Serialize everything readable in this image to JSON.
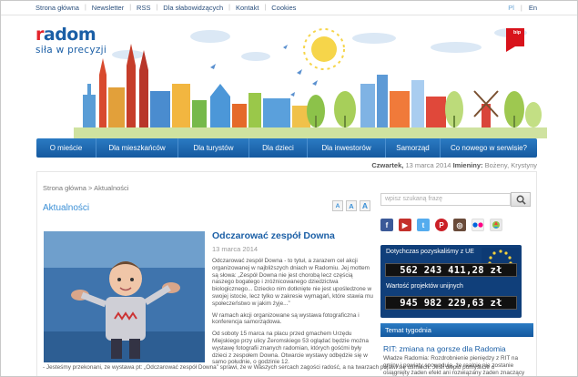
{
  "topnav": {
    "items": [
      "Strona główna",
      "Newsletter",
      "RSS",
      "Dla słabowidzących",
      "Kontakt",
      "Cookies"
    ],
    "lang": {
      "pl": "Pl",
      "en": "En"
    }
  },
  "logo": {
    "mark_r": "r",
    "mark_rest": "adom",
    "tagline": "siła w precyzji"
  },
  "bip": {
    "label": "bip"
  },
  "mainnav": {
    "items": [
      "O mieście",
      "Dla mieszkańców",
      "Dla turystów",
      "Dla dzieci",
      "Dla inwestorów",
      "Samorząd",
      "Co nowego w serwisie?"
    ]
  },
  "datebar": {
    "day": "Czwartek,",
    "date": "13 marca 2014",
    "names_label": "Imieniny:",
    "names": "Bożeny, Krystyny"
  },
  "breadcrumb": {
    "home": "Strona główna",
    "sep": ">",
    "current": "Aktualności"
  },
  "section": {
    "title": "Aktualności",
    "font_sizes": [
      "A",
      "A",
      "A"
    ]
  },
  "article": {
    "title": "Odczarować zespół Downa",
    "date": "13 marca 2014",
    "p1": "Odczarować zespół Downa - to tytuł, a zarazem cel akcji organizowanej w najbliższych dniach w Radomiu. Jej mottem są słowa: „Zespół Downa nie jest chorobą lecz częścią naszego bogatego i zróżnicowanego dziedzictwa biologicznego... Dziecko nim dotknięte nie jest upośledzone w swojej istocie, lecz tylko w zakresie wymagań, które stawia mu społeczeństwo w jakim żyje...”",
    "p2": "W ramach akcji organizowane są wystawa fotograficzna i konferencja samorządowa.",
    "p3": "Od soboty 15 marca na placu przed gmachem Urzędu Miejskiego przy ulicy Żeromskiego 53 oglądać będzie można wystawę fotografii znanych radomian, których gośćmi były dzieci z zespołem Downa. Otwarcie wystawy odbędzie się w samo południe, o godzinie 12.",
    "p4": "- Jesteśmy przekonani, ze wystawa pt: „Odczarować zespół Downa” sprawi, że w Waszych sercach zagości radość, a na twarzach pojawi się uśmiech. Jeśli ciepło pomyślicie o"
  },
  "sidebar": {
    "search_placeholder": "wpisz szukaną frazę",
    "social_icons": [
      "facebook-icon",
      "youtube-icon",
      "twitter-icon",
      "pinterest-icon",
      "instagram-icon",
      "flickr-icon",
      "picasa-icon"
    ],
    "eu": {
      "label1": "Dotychczas pozyskaliśmy z UE",
      "counter1": "562 243 411,28 zł",
      "label2": "Wartość projektów unijnych",
      "counter2": "945 982 229,63 zł"
    },
    "topic": {
      "head": "Temat tygodnia",
      "title": "RIT: zmiana na gorsze dla Radomia",
      "body": "Władze Radomia: Rozdrobnienie pieniędzy z RIT na gminy i powiaty spowoduje, że realnie nie zostanie osiągnięty żaden efekt ani rozwiązany żaden znaczący"
    }
  },
  "colors": {
    "brand_blue": "#1b5fa6",
    "nav_blue": "#2b7bc3",
    "accent_red": "#e3242b",
    "link_light": "#3a8fd6"
  }
}
